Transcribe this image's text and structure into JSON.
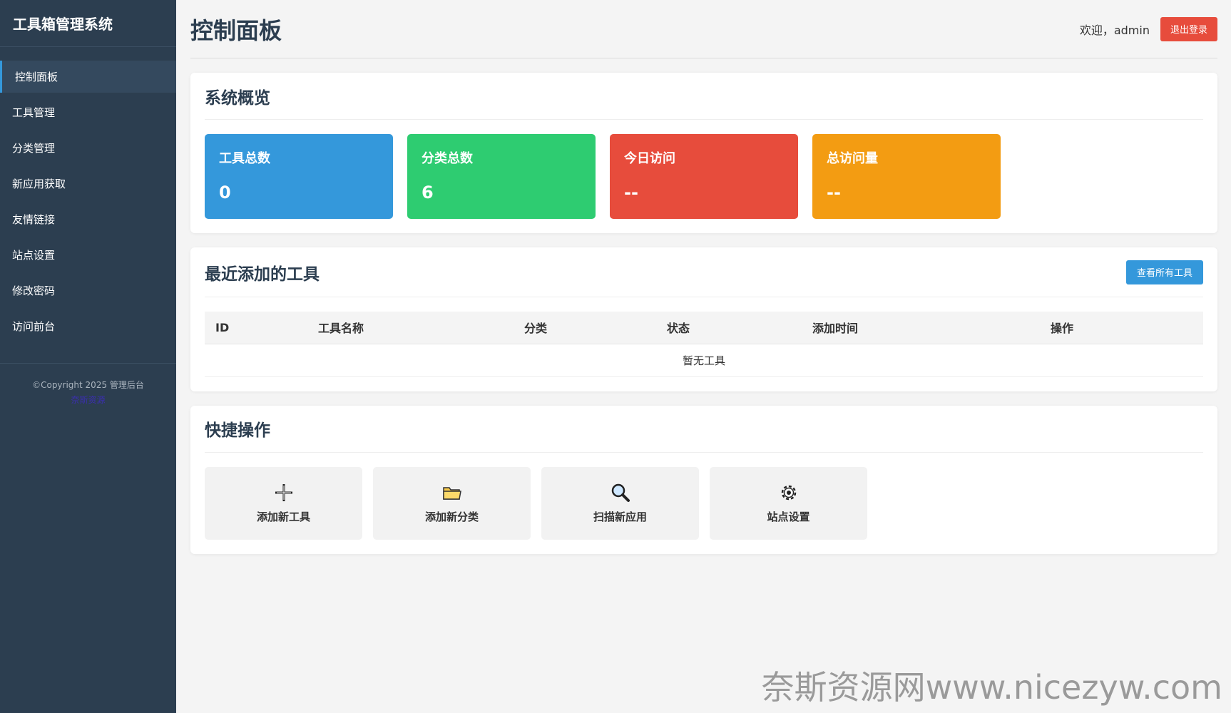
{
  "sidebar": {
    "brand": "工具箱管理系统",
    "items": [
      {
        "label": "控制面板"
      },
      {
        "label": "工具管理"
      },
      {
        "label": "分类管理"
      },
      {
        "label": "新应用获取"
      },
      {
        "label": "友情链接"
      },
      {
        "label": "站点设置"
      },
      {
        "label": "修改密码"
      },
      {
        "label": "访问前台"
      }
    ],
    "copyright": "©Copyright 2025 管理后台",
    "copyright_link": "奈斯资源"
  },
  "header": {
    "title": "控制面板",
    "welcome": "欢迎，admin",
    "logout": "退出登录"
  },
  "overview": {
    "title": "系统概览",
    "stats": [
      {
        "label": "工具总数",
        "value": "0",
        "color": "#3498db"
      },
      {
        "label": "分类总数",
        "value": "6",
        "color": "#2ecc71"
      },
      {
        "label": "今日访问",
        "value": "--",
        "color": "#e74c3c"
      },
      {
        "label": "总访问量",
        "value": "--",
        "color": "#f39c12"
      }
    ]
  },
  "recent": {
    "title": "最近添加的工具",
    "view_all": "查看所有工具",
    "columns": [
      "ID",
      "工具名称",
      "分类",
      "状态",
      "添加时间",
      "操作"
    ],
    "empty": "暂无工具"
  },
  "quick": {
    "title": "快捷操作",
    "items": [
      {
        "label": "添加新工具",
        "icon": "plus-icon"
      },
      {
        "label": "添加新分类",
        "icon": "folder-icon"
      },
      {
        "label": "扫描新应用",
        "icon": "search-icon"
      },
      {
        "label": "站点设置",
        "icon": "gear-icon"
      }
    ]
  },
  "watermark": "奈斯资源网www.nicezyw.com"
}
